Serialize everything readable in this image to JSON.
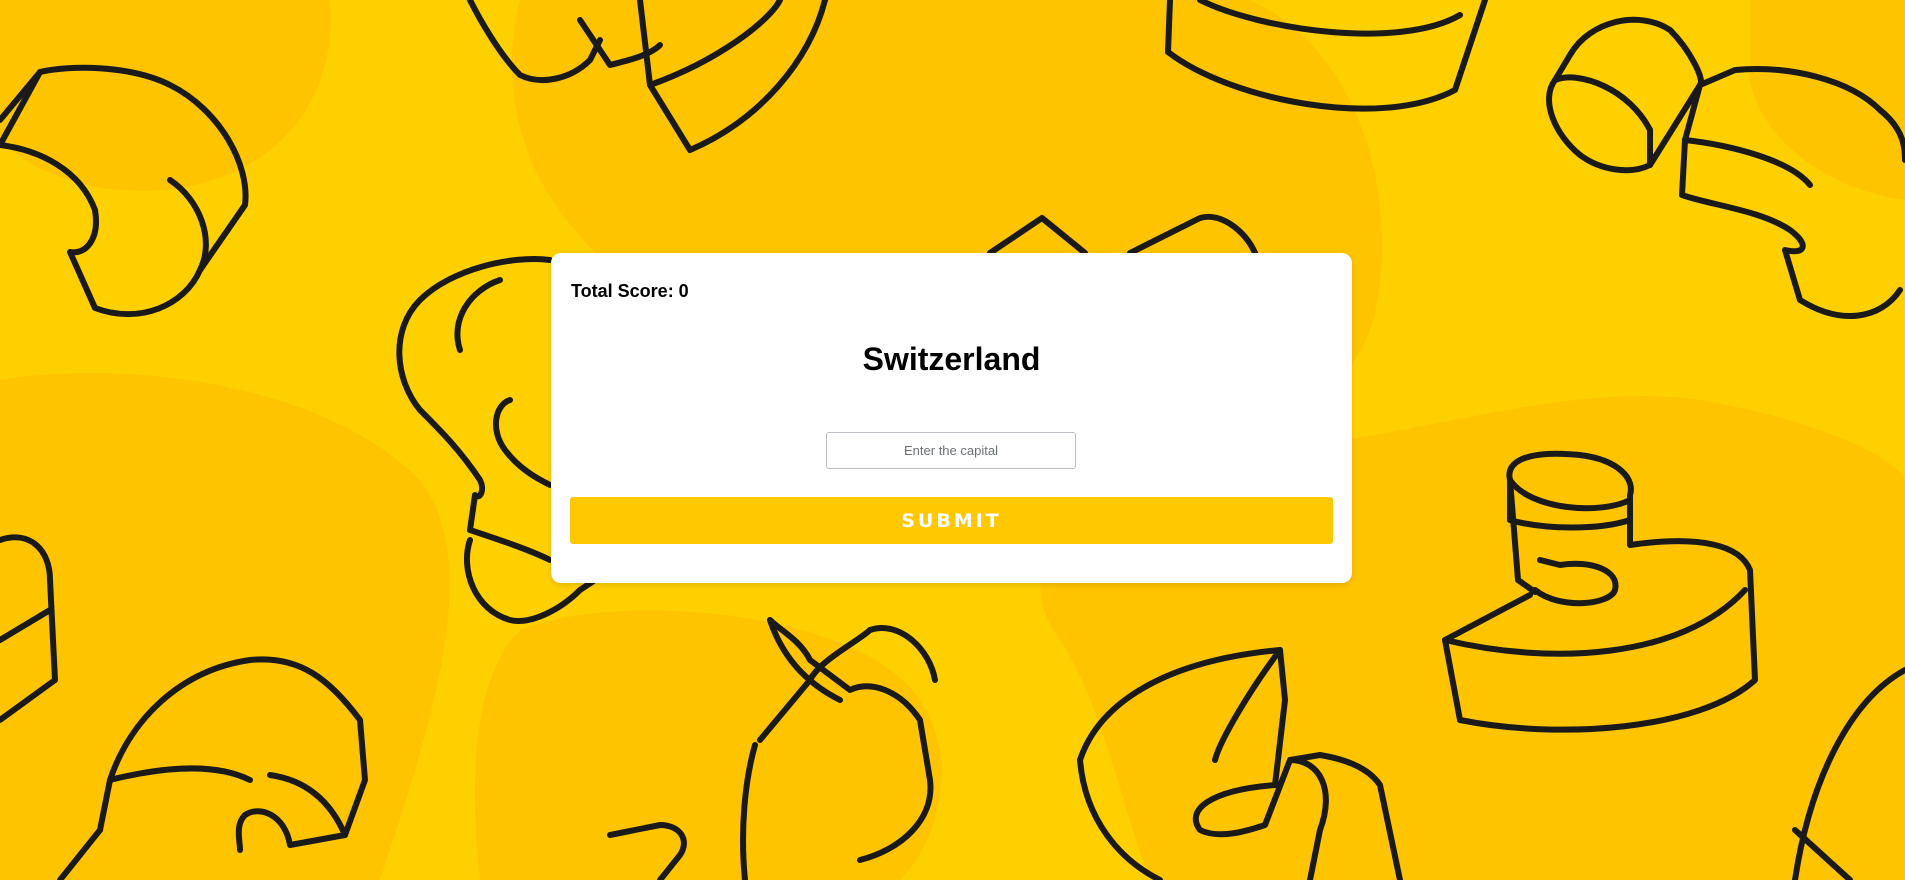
{
  "score": {
    "text": "Total Score: 0"
  },
  "question": {
    "country": "Switzerland"
  },
  "answer": {
    "placeholder": "Enter the capital",
    "value": ""
  },
  "actions": {
    "submit_label": "SUBMIT"
  },
  "theme": {
    "background": "#ffd000",
    "background_blob": "#ffc400",
    "outline": "#1a1a1a",
    "card": "#ffffff",
    "button": "#ffc800"
  }
}
